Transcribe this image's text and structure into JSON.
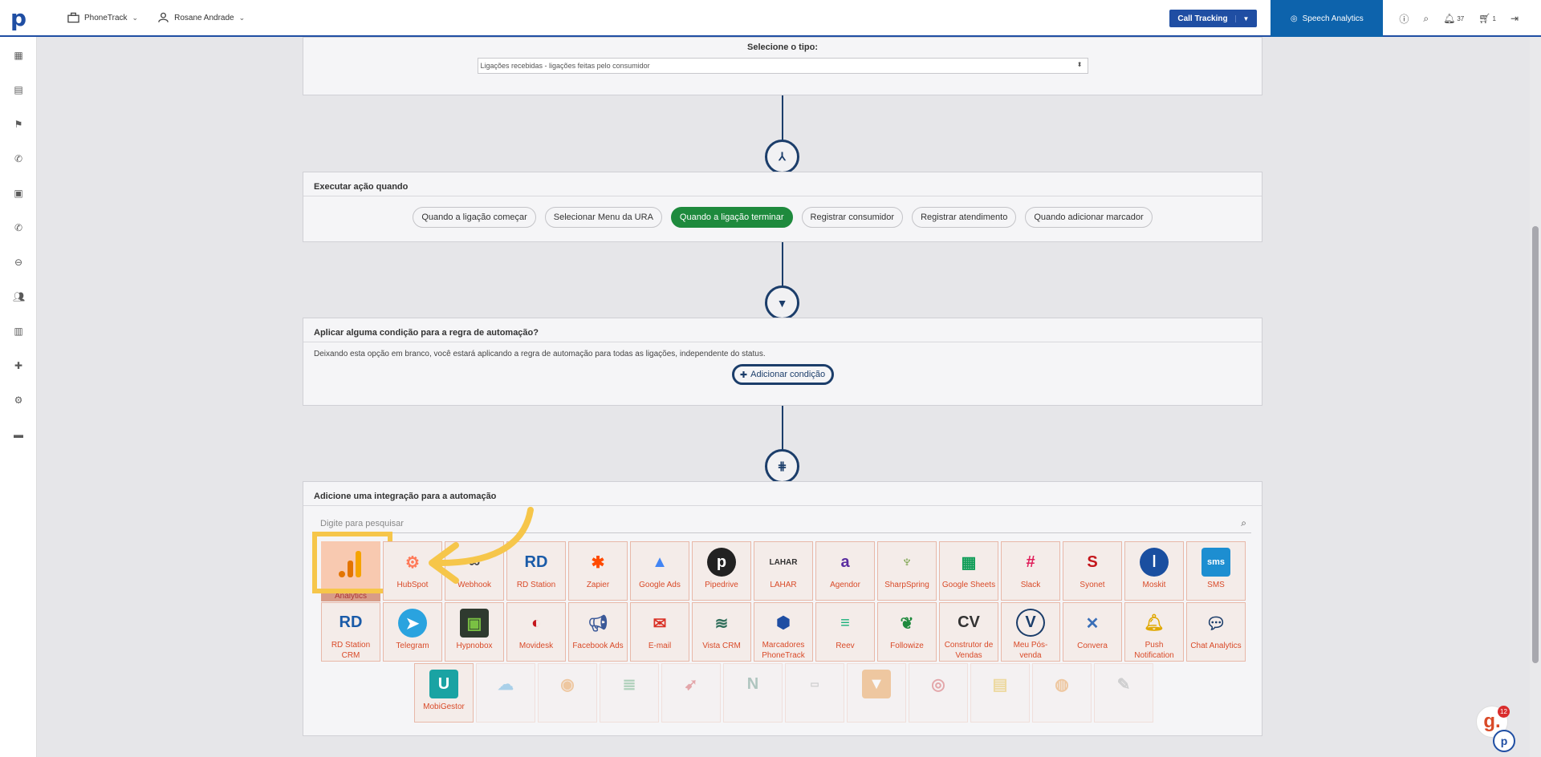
{
  "topbar": {
    "logo": "p",
    "workspace": "PhoneTrack",
    "user": "Rosane Andrade",
    "call_tracking": "Call Tracking",
    "speech": "Speech Analytics",
    "notifications_count": "37",
    "cart_count": "1"
  },
  "tipo": {
    "label": "Selecione o tipo:",
    "value": "Ligações recebidas - ligações feitas pelo consumidor"
  },
  "executar": {
    "title": "Executar ação quando",
    "chips": [
      {
        "label": "Quando a ligação começar"
      },
      {
        "label": "Selecionar Menu da URA"
      },
      {
        "label": "Quando a ligação terminar"
      },
      {
        "label": "Registrar consumidor"
      },
      {
        "label": "Registrar atendimento"
      },
      {
        "label": "Quando adicionar marcador"
      }
    ]
  },
  "condicao": {
    "title": "Aplicar alguma condição para a regra de automação?",
    "text": "Deixando esta opção em branco, você estará aplicando a regra de automação para todas as ligações, independente do status.",
    "button": "Adicionar condição"
  },
  "integracao": {
    "title": "Adicione uma integração para a automação",
    "search_placeholder": "Digite para pesquisar",
    "highlight_tag": "Analytics",
    "row1": [
      "HubSpot",
      "Webhook",
      "RD Station",
      "Zapier",
      "Google Ads",
      "Pipedrive",
      "LAHAR",
      "Agendor",
      "SharpSpring",
      "Google Sheets",
      "Slack",
      "Syonet",
      "Moskit",
      "SMS"
    ],
    "row2": [
      "RD Station CRM",
      "Telegram",
      "Hypnobox",
      "Movidesk",
      "Facebook Ads",
      "E-mail",
      "Vista CRM",
      "Marcadores PhoneTrack",
      "Reev",
      "Followize",
      "Construtor de Vendas",
      "Meu Pós-venda",
      "Convera",
      "Push Notification",
      "Chat Analytics"
    ],
    "row3": [
      "MobiGestor"
    ],
    "icon_texts": {
      "rd": "RD",
      "lahar": "LAHAR",
      "agendor": "a",
      "pipedrive": "p",
      "cv": "CV",
      "sms": "sms"
    }
  },
  "help": {
    "glyph": "g.",
    "badge": "12",
    "logo": "p"
  }
}
